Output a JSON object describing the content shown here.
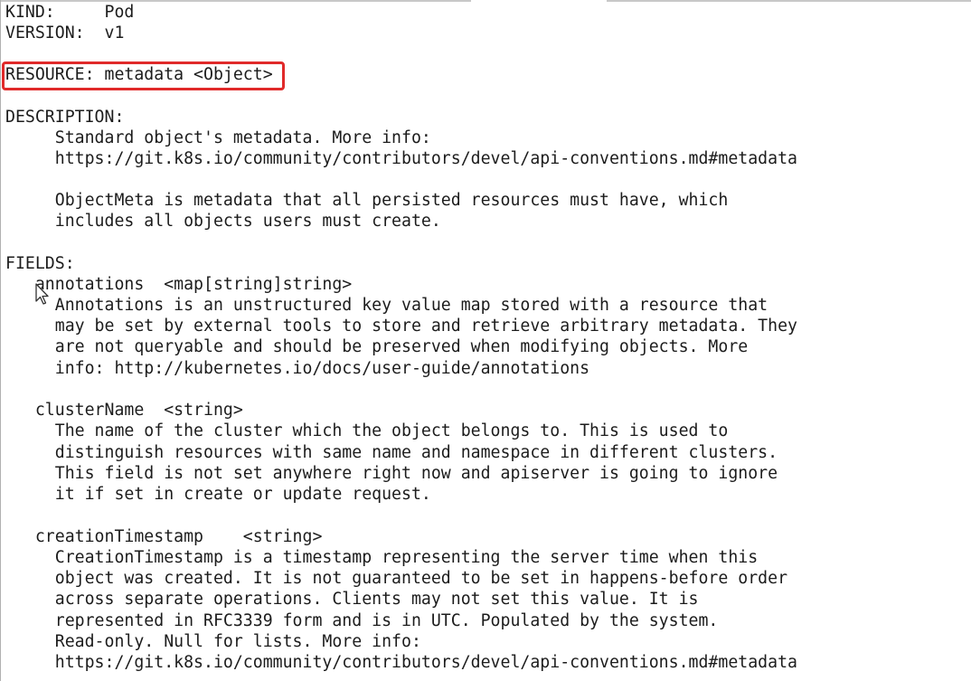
{
  "lines": [
    "KIND:     Pod",
    "VERSION:  v1",
    "",
    "RESOURCE: metadata <Object>",
    "",
    "DESCRIPTION:",
    "     Standard object's metadata. More info:",
    "     https://git.k8s.io/community/contributors/devel/api-conventions.md#metadata",
    "",
    "     ObjectMeta is metadata that all persisted resources must have, which",
    "     includes all objects users must create.",
    "",
    "FIELDS:",
    "   annotations  <map[string]string>",
    "     Annotations is an unstructured key value map stored with a resource that",
    "     may be set by external tools to store and retrieve arbitrary metadata. They",
    "     are not queryable and should be preserved when modifying objects. More",
    "     info: http://kubernetes.io/docs/user-guide/annotations",
    "",
    "   clusterName  <string>",
    "     The name of the cluster which the object belongs to. This is used to",
    "     distinguish resources with same name and namespace in different clusters.",
    "     This field is not set anywhere right now and apiserver is going to ignore",
    "     it if set in create or update request.",
    "",
    "   creationTimestamp    <string>",
    "     CreationTimestamp is a timestamp representing the server time when this",
    "     object was created. It is not guaranteed to be set in happens-before order",
    "     across separate operations. Clients may not set this value. It is",
    "     represented in RFC3339 form and is in UTC. Populated by the system.",
    "     Read-only. Null for lists. More info:",
    "     https://git.k8s.io/community/contributors/devel/api-conventions.md#metadata"
  ],
  "highlight_color": "#e02a2a",
  "text_color": "#1c1c1c",
  "background_color": "#ffffff",
  "cursor_icon": "mouse-pointer-icon"
}
